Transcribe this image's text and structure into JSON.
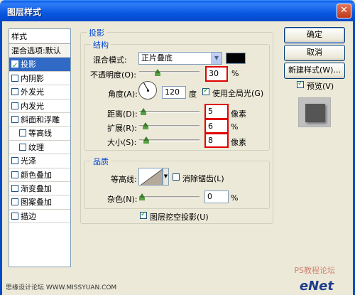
{
  "window": {
    "title": "图层样式"
  },
  "styles_list": {
    "header": "样式",
    "blend_default": "混合选项:默认",
    "items": [
      {
        "label": "投影",
        "checked": true,
        "selected": true,
        "sub": false
      },
      {
        "label": "内阴影",
        "checked": false,
        "selected": false,
        "sub": false
      },
      {
        "label": "外发光",
        "checked": false,
        "selected": false,
        "sub": false
      },
      {
        "label": "内发光",
        "checked": false,
        "selected": false,
        "sub": false
      },
      {
        "label": "斜面和浮雕",
        "checked": false,
        "selected": false,
        "sub": false
      },
      {
        "label": "等高线",
        "checked": false,
        "selected": false,
        "sub": true
      },
      {
        "label": "纹理",
        "checked": false,
        "selected": false,
        "sub": true
      },
      {
        "label": "光泽",
        "checked": false,
        "selected": false,
        "sub": false
      },
      {
        "label": "颜色叠加",
        "checked": false,
        "selected": false,
        "sub": false
      },
      {
        "label": "渐变叠加",
        "checked": false,
        "selected": false,
        "sub": false
      },
      {
        "label": "图案叠加",
        "checked": false,
        "selected": false,
        "sub": false
      },
      {
        "label": "描边",
        "checked": false,
        "selected": false,
        "sub": false
      }
    ]
  },
  "drop_shadow": {
    "title": "投影",
    "structure": {
      "title": "结构",
      "blend_mode_label": "混合模式:",
      "blend_mode_value": "正片叠底",
      "blend_color": "#000000",
      "opacity_label": "不透明度(O):",
      "opacity_value": "30",
      "opacity_unit": "%",
      "angle_label": "角度(A):",
      "angle_value": "120",
      "angle_unit": "度",
      "global_light_label": "使用全局光(G)",
      "global_light_checked": true,
      "distance_label": "距离(D):",
      "distance_value": "5",
      "distance_unit": "像素",
      "spread_label": "扩展(R):",
      "spread_value": "6",
      "spread_unit": "%",
      "size_label": "大小(S):",
      "size_value": "8",
      "size_unit": "像素"
    },
    "quality": {
      "title": "品质",
      "contour_label": "等高线:",
      "anti_alias_label": "消除锯齿(L)",
      "anti_alias_checked": false,
      "noise_label": "杂色(N):",
      "noise_value": "0",
      "noise_unit": "%"
    },
    "knockout_label": "图层挖空投影(U)",
    "knockout_checked": true
  },
  "buttons": {
    "ok": "确定",
    "cancel": "取消",
    "new_style": "新建样式(W)...",
    "preview_label": "预览(V)",
    "preview_checked": true
  },
  "watermarks": {
    "left": "思缘设计论坛 WWW.MISSYUAN.COM",
    "logo": "eNet",
    "logo_top": "PS教程论坛"
  }
}
